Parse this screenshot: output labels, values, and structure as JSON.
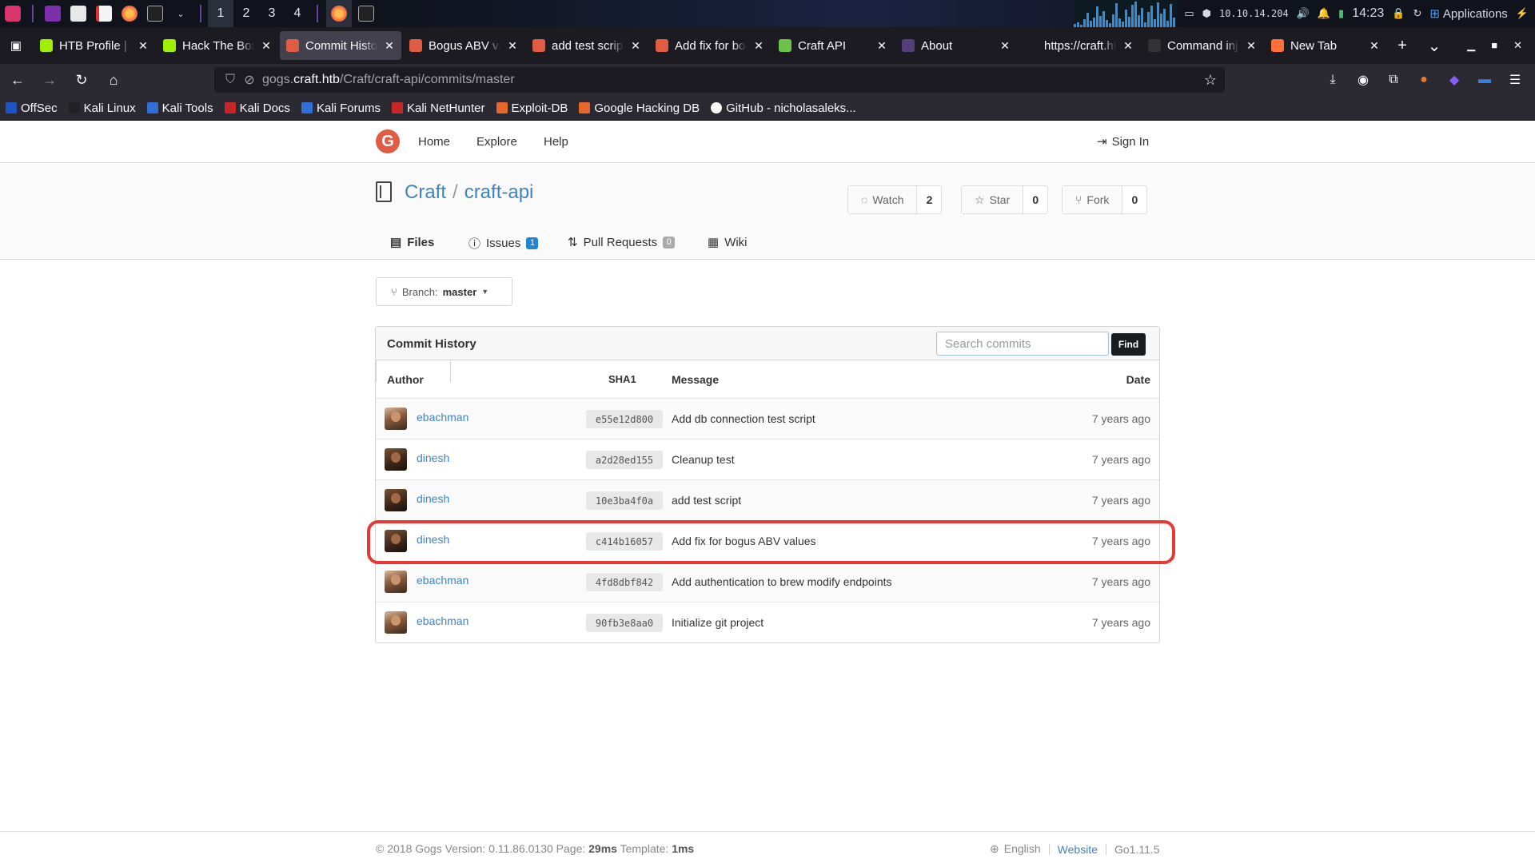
{
  "taskbar": {
    "workspaces": [
      "1",
      "2",
      "3",
      "4"
    ],
    "ip": "10.10.14.204",
    "clock": "14:23",
    "applications_label": "Applications"
  },
  "tabs": [
    {
      "title": "HTB Profile | H",
      "favicon_color": "#9fef00",
      "active": false
    },
    {
      "title": "Hack The Box",
      "favicon_color": "#9fef00",
      "active": false
    },
    {
      "title": "Commit History",
      "favicon_color": "#e05d44",
      "active": true
    },
    {
      "title": "Bogus ABV val",
      "favicon_color": "#e05d44",
      "active": false
    },
    {
      "title": "add test script",
      "favicon_color": "#e05d44",
      "active": false
    },
    {
      "title": "Add fix for bog",
      "favicon_color": "#e05d44",
      "active": false
    },
    {
      "title": "Craft API",
      "favicon_color": "#6cc24a",
      "active": false
    },
    {
      "title": "About",
      "favicon_color": "#563d7c",
      "active": false
    },
    {
      "title": "https://craft.htb/",
      "favicon_color": "",
      "active": false
    },
    {
      "title": "Command inje",
      "favicon_color": "#333333",
      "active": false
    },
    {
      "title": "New Tab",
      "favicon_color": "#ff7139",
      "active": false
    }
  ],
  "url": {
    "prefix": "gogs.",
    "host": "craft.htb",
    "path": "/Craft/craft-api/commits/master"
  },
  "bookmarks": [
    "OffSec",
    "Kali Linux",
    "Kali Tools",
    "Kali Docs",
    "Kali Forums",
    "Kali NetHunter",
    "Exploit-DB",
    "Google Hacking DB",
    "GitHub - nicholasaleks..."
  ],
  "header": {
    "nav": [
      "Home",
      "Explore",
      "Help"
    ],
    "sign_in": "Sign In"
  },
  "repo": {
    "owner": "Craft",
    "name": "craft-api",
    "watch_label": "Watch",
    "watch_count": "2",
    "star_label": "Star",
    "star_count": "0",
    "fork_label": "Fork",
    "fork_count": "0"
  },
  "repo_tabs": {
    "files": "Files",
    "issues": "Issues",
    "issues_count": "1",
    "pulls": "Pull Requests",
    "pulls_count": "0",
    "wiki": "Wiki"
  },
  "branch": {
    "label": "Branch:",
    "value": "master"
  },
  "commits": {
    "title": "Commit History",
    "search_placeholder": "Search commits",
    "find_label": "Find",
    "columns": {
      "author": "Author",
      "sha": "SHA1",
      "message": "Message",
      "date": "Date"
    },
    "rows": [
      {
        "author": "ebachman",
        "sha": "e55e12d800",
        "message": "Add db connection test script",
        "date": "7 years ago"
      },
      {
        "author": "dinesh",
        "sha": "a2d28ed155",
        "message": "Cleanup test",
        "date": "7 years ago"
      },
      {
        "author": "dinesh",
        "sha": "10e3ba4f0a",
        "message": "add test script",
        "date": "7 years ago"
      },
      {
        "author": "dinesh",
        "sha": "c414b16057",
        "message": "Add fix for bogus ABV values",
        "date": "7 years ago"
      },
      {
        "author": "ebachman",
        "sha": "4fd8dbf842",
        "message": "Add authentication to brew modify endpoints",
        "date": "7 years ago"
      },
      {
        "author": "ebachman",
        "sha": "90fb3e8aa0",
        "message": "Initialize git project",
        "date": "7 years ago"
      }
    ]
  },
  "footer": {
    "copyright": "© 2018 Gogs Version: 0.11.86.0130 Page:",
    "page_time": "29ms",
    "template_label": "Template:",
    "template_time": "1ms",
    "language": "English",
    "website": "Website",
    "go_version": "Go1.11.5"
  }
}
